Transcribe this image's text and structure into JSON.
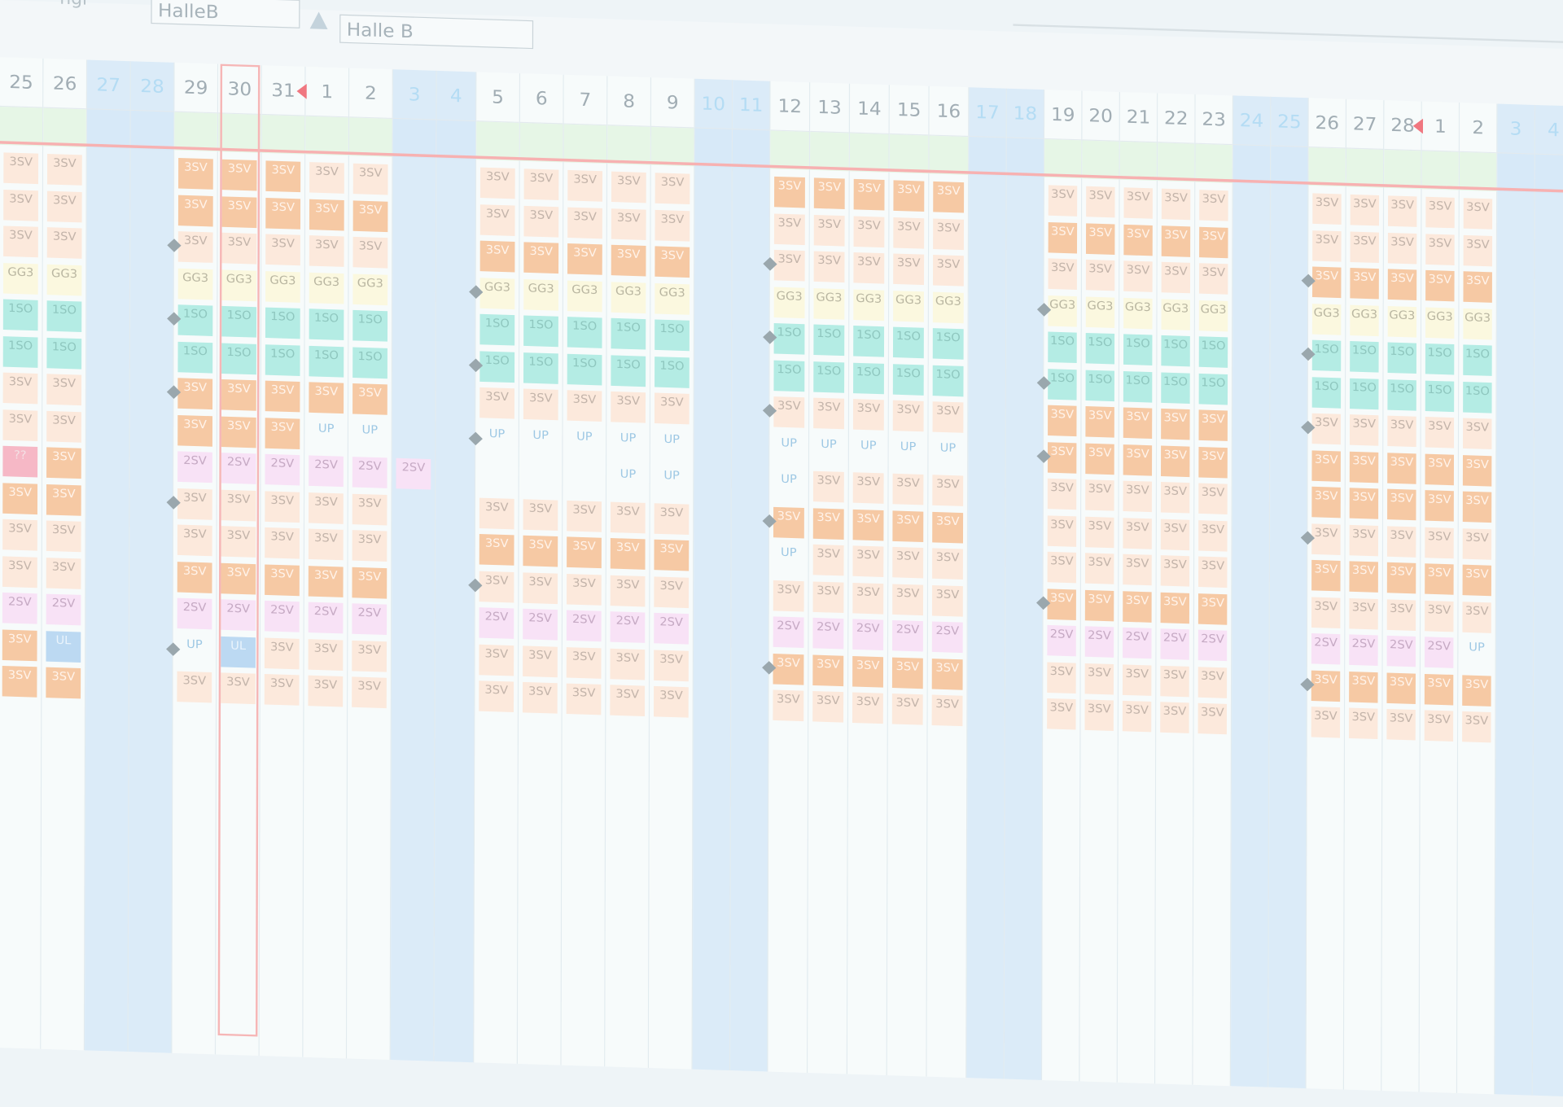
{
  "toolbar": {
    "field_label": "ngr",
    "hall_input_1": "HalleB",
    "hall_input_2": "Halle B"
  },
  "days": [
    "25",
    "26",
    "27",
    "28",
    "29",
    "30",
    "31",
    "1",
    "2",
    "3",
    "4",
    "5",
    "6",
    "7",
    "8",
    "9",
    "10",
    "11",
    "12",
    "13",
    "14",
    "15",
    "16",
    "17",
    "18",
    "19",
    "20",
    "21",
    "22",
    "23",
    "24",
    "25",
    "26",
    "27",
    "28",
    "1",
    "2",
    "3",
    "4"
  ],
  "weekend_flags": [
    0,
    0,
    1,
    1,
    0,
    0,
    0,
    0,
    0,
    1,
    1,
    0,
    0,
    0,
    0,
    0,
    1,
    1,
    0,
    0,
    0,
    0,
    0,
    1,
    1,
    0,
    0,
    0,
    0,
    0,
    1,
    1,
    0,
    0,
    0,
    0,
    0,
    1,
    1
  ],
  "today_index": 5,
  "rows": [
    [
      "3SV",
      "3SV",
      "",
      "",
      "3SV",
      "3SV",
      "3SV",
      "3SV",
      "3SV",
      "",
      "",
      "3SV",
      "3SV",
      "3SV",
      "3SV",
      "3SV",
      "",
      "",
      "3SV",
      "3SV",
      "3SV",
      "3SV",
      "3SV",
      "",
      "",
      "3SV",
      "3SV",
      "3SV",
      "3SV",
      "3SV",
      "",
      "",
      "3SV",
      "3SV",
      "3SV",
      "3SV",
      "3SV",
      "",
      ""
    ],
    [
      "3SV",
      "3SV",
      "",
      "",
      "3SV",
      "3SV",
      "3SV",
      "3SV",
      "3SV",
      "",
      "",
      "3SV",
      "3SV",
      "3SV",
      "3SV",
      "3SV",
      "",
      "",
      "3SV",
      "3SV",
      "3SV",
      "3SV",
      "3SV",
      "",
      "",
      "3SV",
      "3SV",
      "3SV",
      "3SV",
      "3SV",
      "",
      "",
      "3SV",
      "3SV",
      "3SV",
      "3SV",
      "3SV",
      "",
      ""
    ],
    [
      "3SV",
      "3SV",
      "",
      "",
      "3SV",
      "3SV",
      "3SV",
      "3SV",
      "3SV",
      "",
      "",
      "3SV",
      "3SV",
      "3SV",
      "3SV",
      "3SV",
      "",
      "",
      "3SV",
      "3SV",
      "3SV",
      "3SV",
      "3SV",
      "",
      "",
      "3SV",
      "3SV",
      "3SV",
      "3SV",
      "3SV",
      "",
      "",
      "3SV",
      "3SV",
      "3SV",
      "3SV",
      "3SV",
      "",
      ""
    ],
    [
      "GG3",
      "GG3",
      "",
      "",
      "GG3",
      "GG3",
      "GG3",
      "GG3",
      "GG3",
      "",
      "",
      "GG3",
      "GG3",
      "GG3",
      "GG3",
      "GG3",
      "",
      "",
      "GG3",
      "GG3",
      "GG3",
      "GG3",
      "GG3",
      "",
      "",
      "GG3",
      "GG3",
      "GG3",
      "GG3",
      "GG3",
      "",
      "",
      "GG3",
      "GG3",
      "GG3",
      "GG3",
      "GG3",
      "",
      ""
    ],
    [
      "1SO",
      "1SO",
      "",
      "",
      "1SO",
      "1SO",
      "1SO",
      "1SO",
      "1SO",
      "",
      "",
      "1SO",
      "1SO",
      "1SO",
      "1SO",
      "1SO",
      "",
      "",
      "1SO",
      "1SO",
      "1SO",
      "1SO",
      "1SO",
      "",
      "",
      "1SO",
      "1SO",
      "1SO",
      "1SO",
      "1SO",
      "",
      "",
      "1SO",
      "1SO",
      "1SO",
      "1SO",
      "1SO",
      "",
      ""
    ],
    [
      "1SO",
      "1SO",
      "",
      "",
      "1SO",
      "1SO",
      "1SO",
      "1SO",
      "1SO",
      "",
      "",
      "1SO",
      "1SO",
      "1SO",
      "1SO",
      "1SO",
      "",
      "",
      "1SO",
      "1SO",
      "1SO",
      "1SO",
      "1SO",
      "",
      "",
      "1SO",
      "1SO",
      "1SO",
      "1SO",
      "1SO",
      "",
      "",
      "1SO",
      "1SO",
      "1SO",
      "1SO",
      "1SO",
      "",
      ""
    ],
    [
      "3SV",
      "3SV",
      "",
      "",
      "3SV",
      "3SV",
      "3SV",
      "3SV",
      "3SV",
      "",
      "",
      "3SV",
      "3SV",
      "3SV",
      "3SV",
      "3SV",
      "",
      "",
      "3SV",
      "3SV",
      "3SV",
      "3SV",
      "3SV",
      "",
      "",
      "3SV",
      "3SV",
      "3SV",
      "3SV",
      "3SV",
      "",
      "",
      "3SV",
      "3SV",
      "3SV",
      "3SV",
      "3SV",
      "",
      ""
    ],
    [
      "3SV",
      "3SV",
      "",
      "",
      "3SV",
      "3SV",
      "3SV",
      "UP",
      "UP",
      "",
      "",
      "UP",
      "UP",
      "UP",
      "UP",
      "UP",
      "",
      "",
      "UP",
      "UP",
      "UP",
      "UP",
      "UP",
      "",
      "",
      "3SV",
      "3SV",
      "3SV",
      "3SV",
      "3SV",
      "",
      "",
      "3SV",
      "3SV",
      "3SV",
      "3SV",
      "3SV",
      "",
      ""
    ],
    [
      "??",
      "3SV",
      "",
      "",
      "2SV",
      "2SV",
      "2SV",
      "2SV",
      "2SV",
      "2SV",
      "",
      "",
      "",
      "",
      "UP",
      "UP",
      "",
      "",
      "UP",
      "3SV",
      "3SV",
      "3SV",
      "3SV",
      "",
      "",
      "3SV",
      "3SV",
      "3SV",
      "3SV",
      "3SV",
      "",
      "",
      "3SV",
      "3SV",
      "3SV",
      "3SV",
      "3SV",
      "",
      ""
    ],
    [
      "3SV",
      "3SV",
      "",
      "",
      "3SV",
      "3SV",
      "3SV",
      "3SV",
      "3SV",
      "",
      "",
      "3SV",
      "3SV",
      "3SV",
      "3SV",
      "3SV",
      "",
      "",
      "3SV",
      "3SV",
      "3SV",
      "3SV",
      "3SV",
      "",
      "",
      "3SV",
      "3SV",
      "3SV",
      "3SV",
      "3SV",
      "",
      "",
      "3SV",
      "3SV",
      "3SV",
      "3SV",
      "3SV",
      "",
      ""
    ],
    [
      "3SV",
      "3SV",
      "",
      "",
      "3SV",
      "3SV",
      "3SV",
      "3SV",
      "3SV",
      "",
      "",
      "3SV",
      "3SV",
      "3SV",
      "3SV",
      "3SV",
      "",
      "",
      "UP",
      "3SV",
      "3SV",
      "3SV",
      "3SV",
      "",
      "",
      "3SV",
      "3SV",
      "3SV",
      "3SV",
      "3SV",
      "",
      "",
      "3SV",
      "3SV",
      "3SV",
      "3SV",
      "3SV",
      "",
      ""
    ],
    [
      "3SV",
      "3SV",
      "",
      "",
      "3SV",
      "3SV",
      "3SV",
      "3SV",
      "3SV",
      "",
      "",
      "3SV",
      "3SV",
      "3SV",
      "3SV",
      "3SV",
      "",
      "",
      "3SV",
      "3SV",
      "3SV",
      "3SV",
      "3SV",
      "",
      "",
      "3SV",
      "3SV",
      "3SV",
      "3SV",
      "3SV",
      "",
      "",
      "3SV",
      "3SV",
      "3SV",
      "3SV",
      "3SV",
      "",
      ""
    ],
    [
      "2SV",
      "2SV",
      "",
      "",
      "2SV",
      "2SV",
      "2SV",
      "2SV",
      "2SV",
      "",
      "",
      "2SV",
      "2SV",
      "2SV",
      "2SV",
      "2SV",
      "",
      "",
      "2SV",
      "2SV",
      "2SV",
      "2SV",
      "2SV",
      "",
      "",
      "2SV",
      "2SV",
      "2SV",
      "2SV",
      "2SV",
      "",
      "",
      "2SV",
      "2SV",
      "2SV",
      "2SV",
      "UP",
      "",
      ""
    ],
    [
      "3SV",
      "UL",
      "",
      "",
      "UP",
      "UL",
      "3SV",
      "3SV",
      "3SV",
      "",
      "",
      "3SV",
      "3SV",
      "3SV",
      "3SV",
      "3SV",
      "",
      "",
      "3SV",
      "3SV",
      "3SV",
      "3SV",
      "3SV",
      "",
      "",
      "3SV",
      "3SV",
      "3SV",
      "3SV",
      "3SV",
      "",
      "",
      "3SV",
      "3SV",
      "3SV",
      "3SV",
      "3SV",
      "",
      ""
    ],
    [
      "3SV",
      "3SV",
      "",
      "",
      "3SV",
      "3SV",
      "3SV",
      "3SV",
      "3SV",
      "",
      "",
      "3SV",
      "3SV",
      "3SV",
      "3SV",
      "3SV",
      "",
      "",
      "3SV",
      "3SV",
      "3SV",
      "3SV",
      "3SV",
      "",
      "",
      "3SV",
      "3SV",
      "3SV",
      "3SV",
      "3SV",
      "",
      "",
      "3SV",
      "3SV",
      "3SV",
      "3SV",
      "3SV",
      "",
      ""
    ]
  ],
  "dark_3sv": [
    [
      0,
      0,
      0,
      0,
      1,
      1,
      1,
      0,
      0,
      0,
      0,
      0,
      0,
      0,
      0,
      0,
      0,
      0,
      1,
      1,
      1,
      1,
      1,
      0,
      0,
      0,
      0,
      0,
      0,
      0,
      0,
      0,
      0,
      0,
      0,
      0,
      0,
      0,
      0
    ],
    [
      0,
      0,
      0,
      0,
      1,
      1,
      1,
      1,
      1,
      0,
      0,
      0,
      0,
      0,
      0,
      0,
      0,
      0,
      0,
      0,
      0,
      0,
      0,
      0,
      0,
      1,
      1,
      1,
      1,
      1,
      0,
      0,
      0,
      0,
      0,
      0,
      0,
      0,
      0
    ],
    [
      0,
      0,
      0,
      0,
      0,
      0,
      0,
      0,
      0,
      0,
      0,
      1,
      1,
      1,
      1,
      1,
      0,
      0,
      0,
      0,
      0,
      0,
      0,
      0,
      0,
      0,
      0,
      0,
      0,
      0,
      0,
      0,
      1,
      1,
      1,
      1,
      1,
      0,
      0
    ],
    [
      0,
      0,
      0,
      0,
      0,
      0,
      0,
      0,
      0,
      0,
      0,
      0,
      0,
      0,
      0,
      0,
      0,
      0,
      0,
      0,
      0,
      0,
      0,
      0,
      0,
      0,
      0,
      0,
      0,
      0,
      0,
      0,
      0,
      0,
      0,
      0,
      0,
      0,
      0
    ],
    [
      0,
      0,
      0,
      0,
      0,
      0,
      0,
      0,
      0,
      0,
      0,
      0,
      0,
      0,
      0,
      0,
      0,
      0,
      0,
      0,
      0,
      0,
      0,
      0,
      0,
      0,
      0,
      0,
      0,
      0,
      0,
      0,
      0,
      0,
      0,
      0,
      0,
      0,
      0
    ],
    [
      0,
      0,
      0,
      0,
      0,
      0,
      0,
      0,
      0,
      0,
      0,
      0,
      0,
      0,
      0,
      0,
      0,
      0,
      0,
      0,
      0,
      0,
      0,
      0,
      0,
      0,
      0,
      0,
      0,
      0,
      0,
      0,
      0,
      0,
      0,
      0,
      0,
      0,
      0
    ],
    [
      0,
      0,
      0,
      0,
      1,
      1,
      1,
      1,
      1,
      0,
      0,
      0,
      0,
      0,
      0,
      0,
      0,
      0,
      0,
      0,
      0,
      0,
      0,
      0,
      0,
      1,
      1,
      1,
      1,
      1,
      0,
      0,
      0,
      0,
      0,
      0,
      0,
      0,
      0
    ],
    [
      0,
      0,
      0,
      0,
      1,
      1,
      1,
      0,
      0,
      0,
      0,
      0,
      0,
      0,
      0,
      0,
      0,
      0,
      0,
      0,
      0,
      0,
      0,
      0,
      0,
      1,
      1,
      1,
      1,
      1,
      0,
      0,
      1,
      1,
      1,
      1,
      1,
      0,
      0
    ],
    [
      0,
      1,
      0,
      0,
      0,
      0,
      0,
      0,
      0,
      0,
      0,
      0,
      0,
      0,
      0,
      0,
      0,
      0,
      0,
      0,
      0,
      0,
      0,
      0,
      0,
      0,
      0,
      0,
      0,
      0,
      0,
      0,
      1,
      1,
      1,
      1,
      1,
      0,
      0
    ],
    [
      1,
      1,
      0,
      0,
      0,
      0,
      0,
      0,
      0,
      0,
      0,
      0,
      0,
      0,
      0,
      0,
      0,
      0,
      1,
      1,
      1,
      1,
      1,
      0,
      0,
      0,
      0,
      0,
      0,
      0,
      0,
      0,
      0,
      0,
      0,
      0,
      0,
      0,
      0
    ],
    [
      0,
      0,
      0,
      0,
      0,
      0,
      0,
      0,
      0,
      0,
      0,
      1,
      1,
      1,
      1,
      1,
      0,
      0,
      0,
      0,
      0,
      0,
      0,
      0,
      0,
      0,
      0,
      0,
      0,
      0,
      0,
      0,
      1,
      1,
      1,
      1,
      1,
      0,
      0
    ],
    [
      0,
      0,
      0,
      0,
      1,
      1,
      1,
      1,
      1,
      0,
      0,
      0,
      0,
      0,
      0,
      0,
      0,
      0,
      0,
      0,
      0,
      0,
      0,
      0,
      0,
      1,
      1,
      1,
      1,
      1,
      0,
      0,
      0,
      0,
      0,
      0,
      0,
      0,
      0
    ],
    [
      0,
      0,
      0,
      0,
      0,
      0,
      0,
      0,
      0,
      0,
      0,
      0,
      0,
      0,
      0,
      0,
      0,
      0,
      0,
      0,
      0,
      0,
      0,
      0,
      0,
      0,
      0,
      0,
      0,
      0,
      0,
      0,
      0,
      0,
      0,
      0,
      0,
      0,
      0
    ],
    [
      1,
      0,
      0,
      0,
      0,
      0,
      0,
      0,
      0,
      0,
      0,
      0,
      0,
      0,
      0,
      0,
      0,
      0,
      1,
      1,
      1,
      1,
      1,
      0,
      0,
      0,
      0,
      0,
      0,
      0,
      0,
      0,
      1,
      1,
      1,
      1,
      1,
      0,
      0
    ],
    [
      1,
      1,
      0,
      0,
      0,
      0,
      0,
      0,
      0,
      0,
      0,
      0,
      0,
      0,
      0,
      0,
      0,
      0,
      0,
      0,
      0,
      0,
      0,
      0,
      0,
      0,
      0,
      0,
      0,
      0,
      0,
      0,
      0,
      0,
      0,
      0,
      0,
      0,
      0
    ]
  ]
}
